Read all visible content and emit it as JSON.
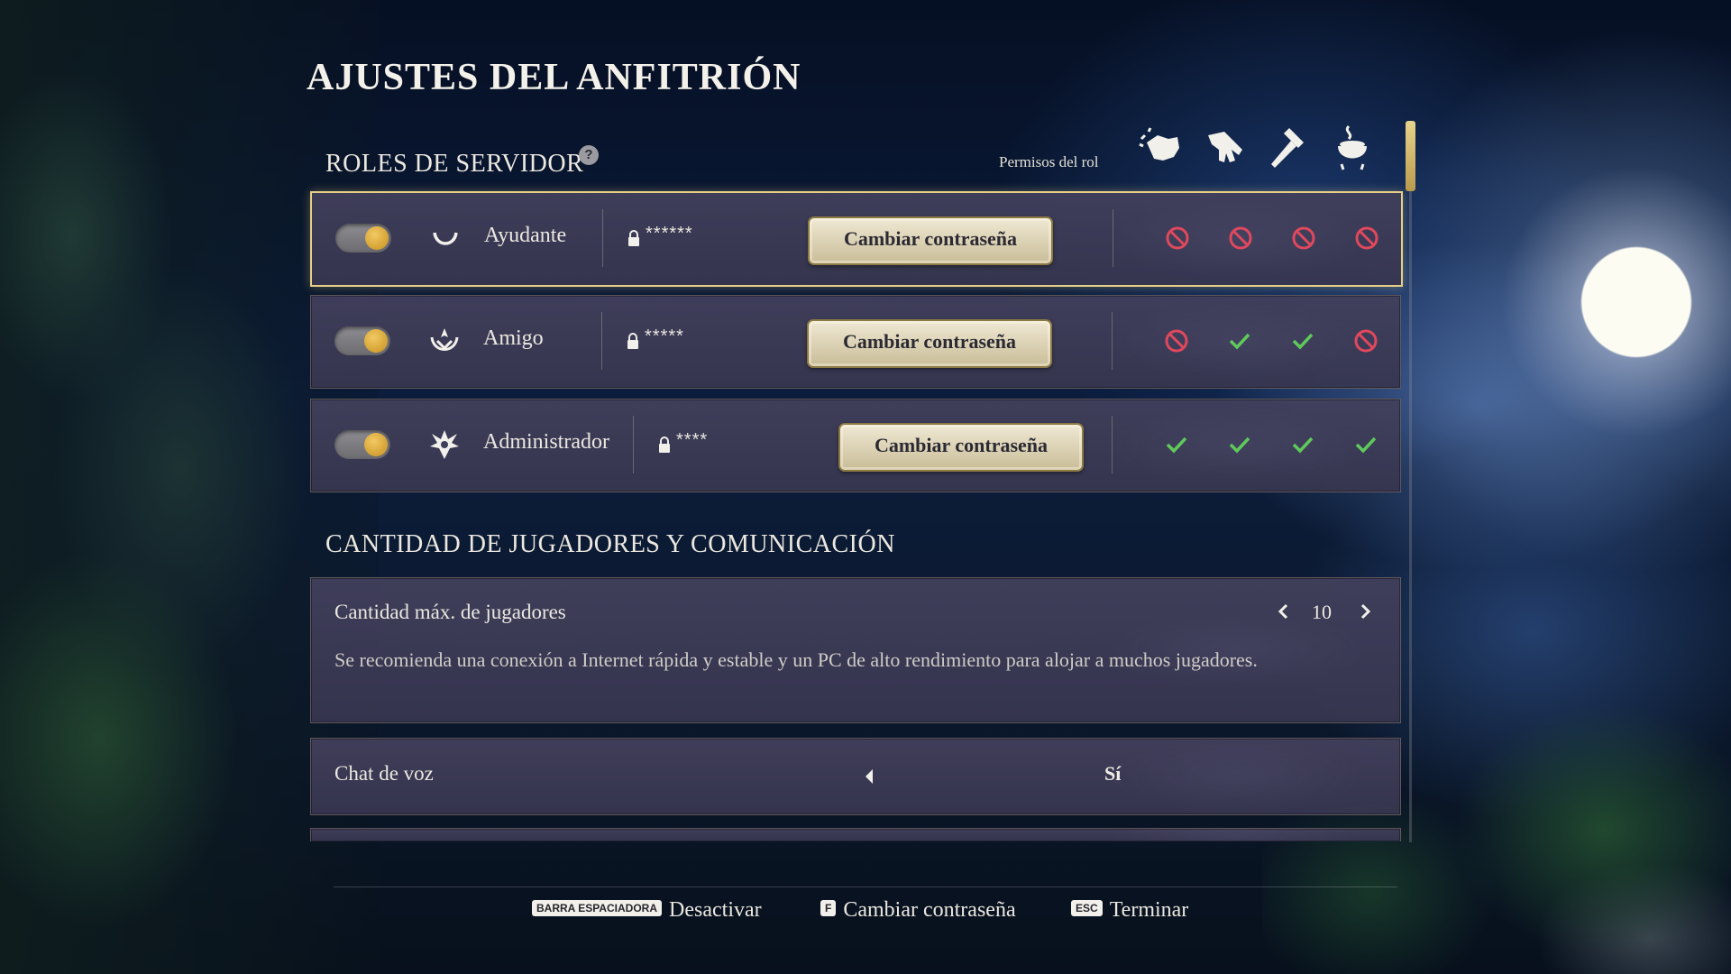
{
  "title": "AJUSTES DEL ANFITRIÓN",
  "roles_section": {
    "header": "ROLES DE SERVIDOR",
    "help_icon": "?",
    "permissions_label": "Permisos del rol",
    "permission_icons": [
      "fist-icon",
      "glove-icon",
      "hammer-icon",
      "cauldron-icon"
    ],
    "roles": [
      {
        "name": "Ayudante",
        "icon": "helper-rune-icon",
        "enabled": true,
        "password_mask": "******",
        "button_label": "Cambiar contraseña",
        "permissions": [
          "denied",
          "denied",
          "denied",
          "denied"
        ],
        "selected": true
      },
      {
        "name": "Amigo",
        "icon": "friend-rune-icon",
        "enabled": true,
        "password_mask": "*****",
        "button_label": "Cambiar contraseña",
        "permissions": [
          "denied",
          "allowed",
          "allowed",
          "denied"
        ],
        "selected": false
      },
      {
        "name": "Administrador",
        "icon": "admin-rune-icon",
        "enabled": true,
        "password_mask": "****",
        "button_label": "Cambiar contraseña",
        "permissions": [
          "allowed",
          "allowed",
          "allowed",
          "allowed"
        ],
        "selected": false
      }
    ]
  },
  "players_section": {
    "header": "CANTIDAD DE JUGADORES Y COMUNICACIÓN",
    "max_players": {
      "label": "Cantidad máx. de jugadores",
      "value": "10",
      "description": "Se recomienda una conexión a Internet rápida y estable y un PC de alto rendimiento para alojar a muchos jugadores."
    },
    "voice_chat": {
      "label": "Chat de voz",
      "value": "Sí"
    }
  },
  "footer": {
    "hints": [
      {
        "key": "BARRA ESPACIADORA",
        "action": "Desactivar"
      },
      {
        "key": "F",
        "action": "Cambiar contraseña"
      },
      {
        "key": "ESC",
        "action": "Terminar"
      }
    ]
  },
  "colors": {
    "accent_gold": "#e6cf86",
    "toggle_knob": "#e0a935",
    "denied": "#e0485c",
    "allowed": "#5fc95a",
    "panel": "#3f3e5a"
  }
}
